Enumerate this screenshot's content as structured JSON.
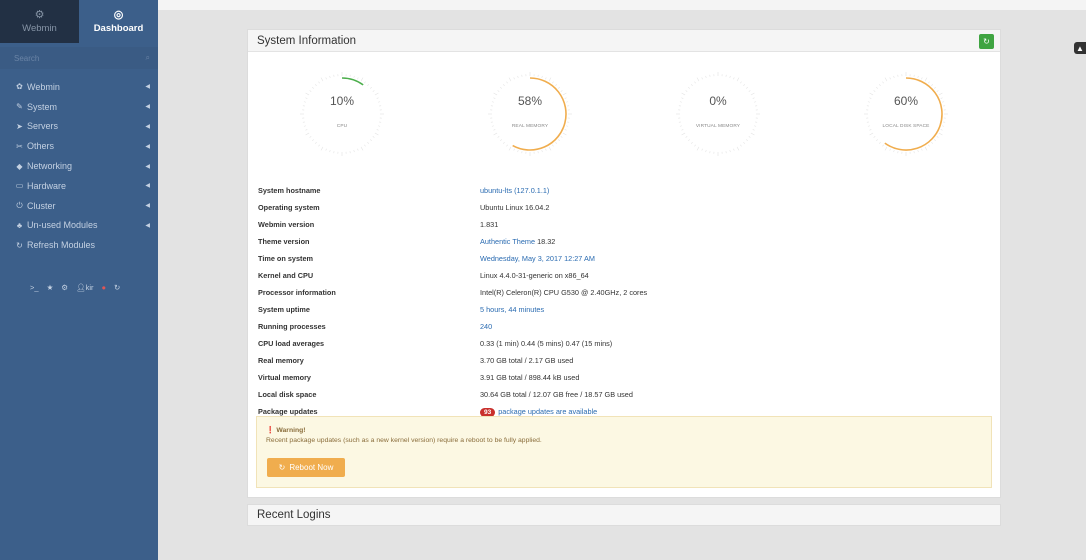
{
  "sidebar": {
    "tab_webmin": "Webmin",
    "tab_dashboard": "Dashboard",
    "search_placeholder": "Search",
    "items": [
      {
        "label": "Webmin",
        "icon": "gear-icon"
      },
      {
        "label": "System",
        "icon": "wrench-icon"
      },
      {
        "label": "Servers",
        "icon": "rocket-icon"
      },
      {
        "label": "Others",
        "icon": "tools-icon"
      },
      {
        "label": "Networking",
        "icon": "shield-icon"
      },
      {
        "label": "Hardware",
        "icon": "hdd-icon"
      },
      {
        "label": "Cluster",
        "icon": "power-icon"
      },
      {
        "label": "Un-used Modules",
        "icon": "puzzle-icon"
      },
      {
        "label": "Refresh Modules",
        "icon": "refresh-icon"
      }
    ],
    "tools": {
      "user": "kir"
    }
  },
  "system_info": {
    "title": "System Information",
    "gauges": [
      {
        "value": "10%",
        "percent": 10,
        "label": "CPU",
        "color": "#4cae4c"
      },
      {
        "value": "58%",
        "percent": 58,
        "label": "REAL MEMORY",
        "color": "#f0ad4e"
      },
      {
        "value": "0%",
        "percent": 0,
        "label": "VIRTUAL MEMORY",
        "color": "#4cae4c"
      },
      {
        "value": "60%",
        "percent": 60,
        "label": "LOCAL DISK SPACE",
        "color": "#f0ad4e"
      }
    ],
    "rows": [
      {
        "key": "System hostname",
        "value": "ubuntu-lts (127.0.1.1)",
        "link": true
      },
      {
        "key": "Operating system",
        "value": "Ubuntu Linux 16.04.2",
        "link": false
      },
      {
        "key": "Webmin version",
        "value": "1.831",
        "link": false
      },
      {
        "key": "Theme version",
        "value": "Authentic Theme",
        "value2": "18.32",
        "link": true
      },
      {
        "key": "Time on system",
        "value": "Wednesday, May 3, 2017 12:27 AM",
        "link": true
      },
      {
        "key": "Kernel and CPU",
        "value": "Linux 4.4.0-31-generic on x86_64",
        "link": false
      },
      {
        "key": "Processor information",
        "value": "Intel(R) Celeron(R) CPU G530 @ 2.40GHz, 2 cores",
        "link": false
      },
      {
        "key": "System uptime",
        "value": "5 hours, 44 minutes",
        "link": true
      },
      {
        "key": "Running processes",
        "value": "240",
        "link": true
      },
      {
        "key": "CPU load averages",
        "value": "0.33 (1 min) 0.44 (5 mins) 0.47 (15 mins)",
        "link": false
      },
      {
        "key": "Real memory",
        "value": "3.70 GB total / 2.17 GB used",
        "link": false
      },
      {
        "key": "Virtual memory",
        "value": "3.91 GB total / 898.44 kB used",
        "link": false
      },
      {
        "key": "Local disk space",
        "value": "30.64 GB total / 12.07 GB free / 18.57 GB used",
        "link": false
      },
      {
        "key": "Package updates",
        "badge": "93",
        "value": "package updates are available",
        "link": true
      }
    ],
    "warning": {
      "title": "Warning!",
      "text": "Recent package updates (such as a new kernel version) require a reboot to be fully applied.",
      "button": "Reboot Now"
    }
  },
  "recent_logins": {
    "title": "Recent Logins"
  },
  "colors": {
    "sidebar": "#3c5f8a",
    "accent_green": "#3fa441",
    "warning_orange": "#f0ad4e",
    "link": "#2a6bb1"
  }
}
